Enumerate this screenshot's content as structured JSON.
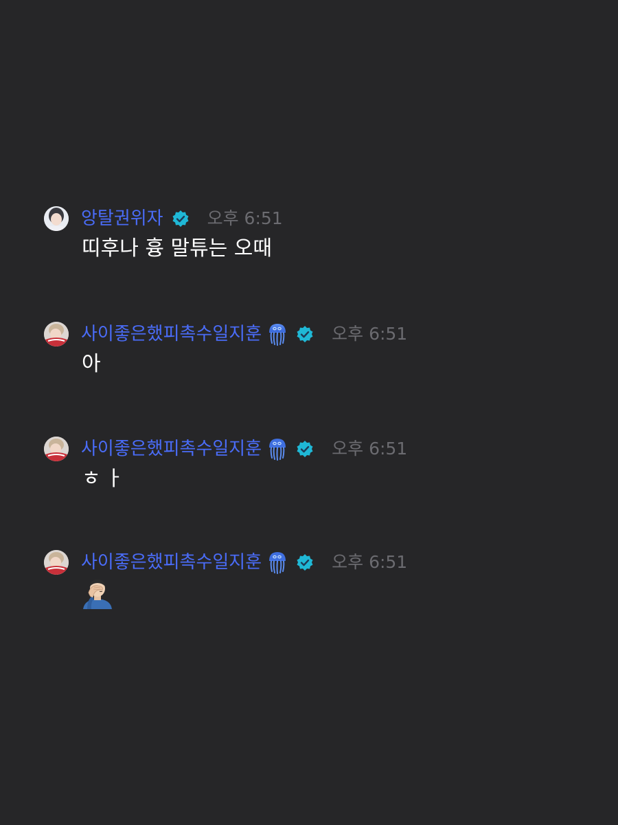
{
  "messages": [
    {
      "author": "앙탈권위자",
      "has_jellyfish": false,
      "time": "오후 6:51",
      "text": "띠후나 흉 말튜는 오때"
    },
    {
      "author": "사이좋은했피촉수일지훈",
      "has_jellyfish": true,
      "time": "오후 6:51",
      "text": "아"
    },
    {
      "author": "사이좋은했피촉수일지훈",
      "has_jellyfish": true,
      "time": "오후 6:51",
      "text": "ㅎㅏ"
    },
    {
      "author": "사이좋은했피촉수일지훈",
      "has_jellyfish": true,
      "time": "오후 6:51",
      "emoji": "facepalm-man-emoji"
    }
  ],
  "colors": {
    "background": "#262628",
    "author_name": "#4a6cf7",
    "timestamp": "#6b6b70",
    "message_text": "#ffffff",
    "verified_badge": "#1fb8d6"
  },
  "icons": {
    "verified": "verified-badge-icon",
    "jellyfish": "jellyfish-emoji"
  }
}
